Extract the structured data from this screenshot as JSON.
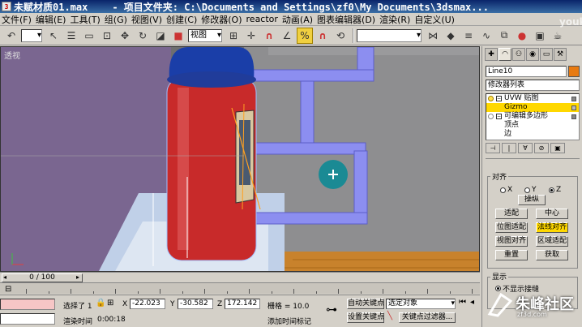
{
  "window": {
    "filename": "未赋材质01.max",
    "title": "- 项目文件夹: C:\\Documents and Settings\\zf0\\My Documents\\3dsmax..."
  },
  "menu": [
    "文件(F)",
    "编辑(E)",
    "工具(T)",
    "组(G)",
    "视图(V)",
    "创建(C)",
    "修改器(O)",
    "reactor",
    "动画(A)",
    "图表编辑器(D)",
    "渲染(R)",
    "自定义(U)"
  ],
  "toolbar": {
    "selection_filter": "",
    "ref_coord": "视图",
    "named_selection": ""
  },
  "viewport": {
    "label": "透视"
  },
  "command_panel": {
    "object_name": "Line10",
    "modifier_list": "修改器列表",
    "stack": [
      {
        "label": "UVW 贴图",
        "selected": false
      },
      {
        "label": "Gizmo",
        "selected": true
      },
      {
        "label": "可编辑多边形",
        "selected": false
      },
      {
        "label": "顶点",
        "selected": false
      },
      {
        "label": "边",
        "selected": false
      }
    ],
    "align_group": "对齐",
    "axis": [
      "X",
      "Y",
      "Z"
    ],
    "axis_selected": "Z",
    "flip_btn": "操纵",
    "buttons": [
      [
        "适配",
        "中心"
      ],
      [
        "位图适配",
        "法线对齐"
      ],
      [
        "视图对齐",
        "区域适配"
      ],
      [
        "重置",
        "获取"
      ]
    ],
    "display_title": "显示",
    "display_option": "不显示接缝"
  },
  "timeline": {
    "frame": "0 / 100"
  },
  "status": {
    "selected": "选择了 1",
    "x_label": "X",
    "x_value": "-22.023",
    "y_label": "Y",
    "y_value": "-30.582",
    "z_label": "Z",
    "z_value": "172.142",
    "grid": "栅格 = 10.0",
    "autokey": "自动关键点",
    "setkey": "设置关键点",
    "selected_obj": "选定对象",
    "key_filter": "关键点过滤器...",
    "render_time_label": "渲染时间",
    "render_time": "0:00:18",
    "add_time_tag": "添加时间标记"
  },
  "watermark": {
    "text": "朱峰社区",
    "sub": "zf3d.com"
  },
  "corner_logo": "youku"
}
